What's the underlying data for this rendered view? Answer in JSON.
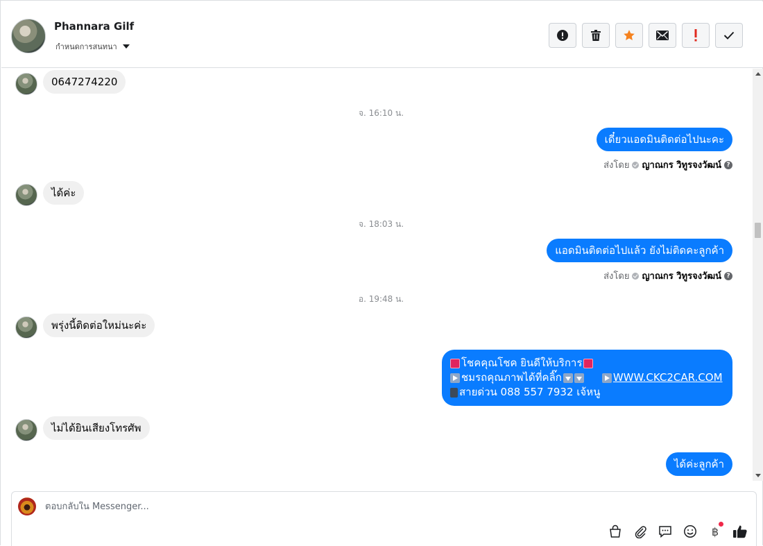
{
  "header": {
    "contact_name": "Phannara Gilf",
    "conversation_setting": "กำหนดการสนทนา",
    "toolbar": [
      {
        "name": "report-button",
        "icon": "alert-circle-icon"
      },
      {
        "name": "delete-button",
        "icon": "trash-icon"
      },
      {
        "name": "star-button",
        "icon": "star-icon"
      },
      {
        "name": "mark-unread-button",
        "icon": "envelope-icon"
      },
      {
        "name": "spam-button",
        "icon": "exclamation-icon"
      },
      {
        "name": "done-button",
        "icon": "checkmark-icon"
      }
    ]
  },
  "messages": {
    "m1": "0647274220",
    "ts1": "จ. 16:10 น.",
    "m2": "เดี๋ยวแอดมินติดต่อไปนะคะ",
    "sent_prefix": "ส่งโดย",
    "sender": "ญาณกร วิทูรจงวัฒน์",
    "m3": "ได้ค่ะ",
    "ts2": "จ. 18:03 น.",
    "m4": "แอดมินติดต่อไปแล้ว ยังไม่ติดคะลูกค้า",
    "ts3": "อ. 19:48 น.",
    "m5": "พรุ่งนี้ติดต่อใหม่นะค่ะ",
    "promo_line1": "โชคคุณโชค ยินดีให้บริการ",
    "promo_line2": "ชมรถคุณภาพได้ที่คลิ๊ก",
    "promo_link": "WWW.CKC2CAR.COM",
    "promo_line3": "สายด่วน 088 557 7932 เจ้หนู",
    "m6": "ไม่ได้ยินเสียงโทรศัพ",
    "m7": "ได้ค่ะลูกค้า"
  },
  "composer": {
    "placeholder": "ตอบกลับใน Messenger...",
    "tools": [
      "shopping-bag-icon",
      "paperclip-icon",
      "saved-replies-icon",
      "emoji-icon",
      "payment-icon",
      "thumbs-up-icon"
    ],
    "payment_symbol": "฿"
  },
  "colors": {
    "outgoing_bubble": "#0a7cff",
    "incoming_bubble": "#f0f0f0",
    "star": "#f5821f",
    "spam": "#e02a1f"
  }
}
